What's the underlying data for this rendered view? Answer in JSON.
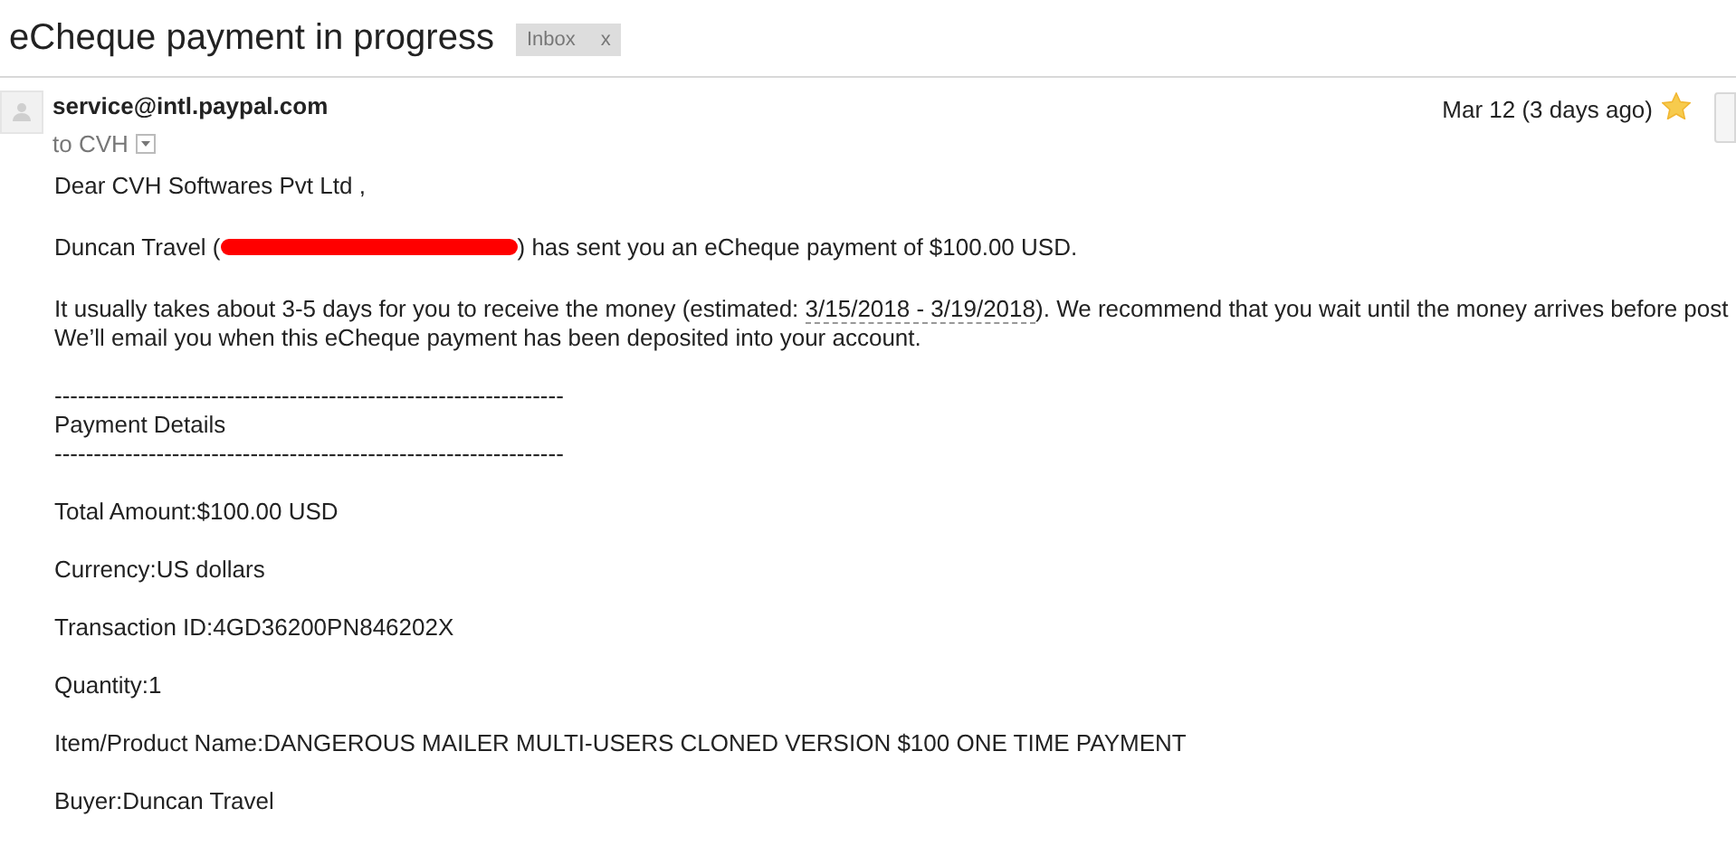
{
  "subject": "eCheque payment in progress",
  "label": {
    "text": "Inbox",
    "close": "x"
  },
  "sender": "service@intl.paypal.com",
  "recipient": {
    "text": "to CVH"
  },
  "date": "Mar 12 (3 days ago)",
  "starred": true,
  "body": {
    "greeting": "Dear CVH Softwares Pvt Ltd ,",
    "sent_line": {
      "before": "Duncan Travel (",
      "after": ") has sent you an eCheque payment of $100.00 USD.",
      "redacted": true
    },
    "info_line_1": {
      "before": "It usually takes about 3-5 days for you to receive the money (estimated: ",
      "date_range": "3/15/2018 - 3/19/2018",
      "after": "). We recommend that you wait until the money arrives before post"
    },
    "info_line_2": "We’ll email you when this eCheque payment has been deposited into your account.",
    "separator_top": "-----------------------------------------------------------------",
    "details_heading": "Payment Details",
    "separator_bottom": "-----------------------------------------------------------------",
    "details": [
      {
        "text": "Total Amount:$100.00 USD"
      },
      {
        "text": "Currency:US dollars"
      },
      {
        "text": "Transaction ID:4GD36200PN846202X"
      },
      {
        "text": "Quantity:1"
      },
      {
        "text": "Item/Product Name:DANGEROUS MAILER MULTI-USERS CLONED VERSION $100 ONE TIME PAYMENT"
      },
      {
        "text": "Buyer:Duncan Travel"
      }
    ]
  }
}
